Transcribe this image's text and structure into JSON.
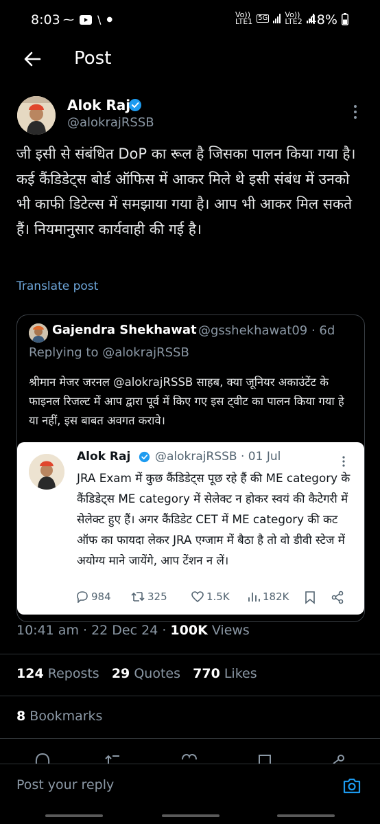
{
  "status": {
    "time": "8:03",
    "battery": "48%",
    "net_left": [
      "Vo))",
      "LTE1"
    ],
    "net_mid": "5G",
    "net_right": [
      "Vo))",
      "LTE2"
    ]
  },
  "appbar": {
    "title": "Post"
  },
  "post": {
    "author_name": "Alok Raj",
    "author_handle": "@alokrajRSSB",
    "body": "जी इसी से संबंधित DoP का रूल है जिसका पालन किया गया है। कई कैंडिडेट्स बोर्ड ऑफिस में आकर मिले थे इसी संबंध में उनको भी काफी डिटेल्स में समझाया गया है। आप भी आकर मिल सकते हैं। नियमानुसार कार्यवाही की गई है।",
    "translate": "Translate post",
    "time": "10:41 am",
    "date": "22 Dec 24",
    "views_count": "100K",
    "views_label": "Views"
  },
  "quote": {
    "name": "Gajendra Shekhawat",
    "handle": "@gsshekhawat09",
    "age": "6d",
    "replying_prefix": "Replying to",
    "replying_handle": "@alokrajRSSB",
    "text": "श्रीमान मेजर जरनल @alokrajRSSB साहब, क्या जूनियर अकाउंटेंट के फाइनल रिजल्ट में आप द्वारा पूर्व में किए गए इस ट्वीट का पालन किया गया हे या नहीं, इस बाबत अवगत करावे।"
  },
  "embed": {
    "name": "Alok Raj",
    "handle": "@alokrajRSSB",
    "date": "01 Jul",
    "text": "JRA Exam में कुछ कैंडिडेट्स पूछ रहे हैं की ME category के कैंडिडेट्स ME category में सेलेक्ट न होकर स्वयं की कैटेगरी में सेलेक्ट हुए हैं। अगर कैंडिडेट CET में ME category की कट ऑफ का फायदा लेकर JRA एग्जाम में बैठा है तो वो डीवी स्टेज में अयोग्य माने जायेंगे, आप टेंशन न लें।",
    "replies": "984",
    "reposts": "325",
    "likes": "1.5K",
    "views": "182K"
  },
  "stats": {
    "reposts_count": "124",
    "reposts_label": "Reposts",
    "quotes_count": "29",
    "quotes_label": "Quotes",
    "likes_count": "770",
    "likes_label": "Likes",
    "bookmarks_count": "8",
    "bookmarks_label": "Bookmarks"
  },
  "reply": {
    "placeholder": "Post your reply"
  },
  "colors": {
    "background": "#000000",
    "accent": "#1d9bf0",
    "link": "#6fa8dc",
    "muted": "#8b98a5"
  },
  "icons": [
    "back-arrow-icon",
    "verified-icon",
    "more-vertical-icon",
    "reply-icon",
    "repost-icon",
    "like-icon",
    "views-icon",
    "bookmark-icon",
    "share-icon",
    "camera-icon"
  ]
}
